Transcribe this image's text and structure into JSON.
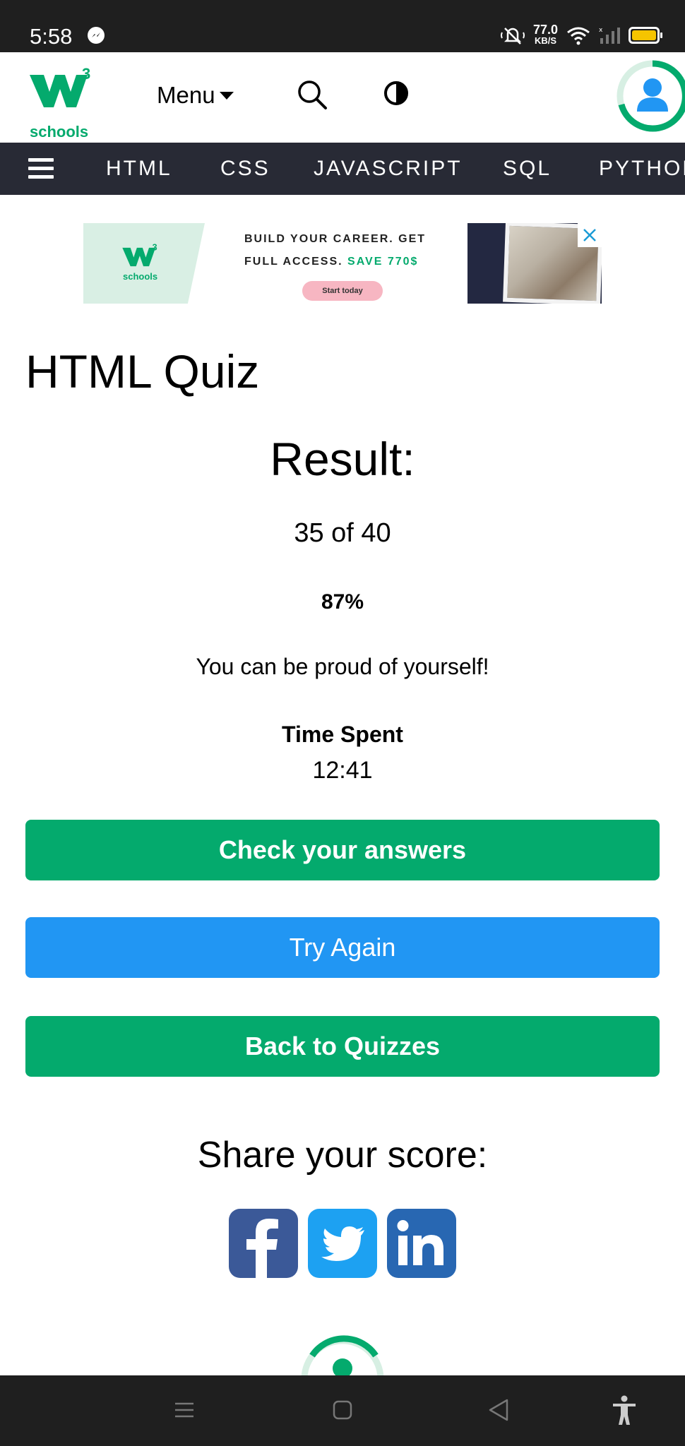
{
  "status_bar": {
    "time": "5:58",
    "net_speed": "77.0",
    "net_speed_unit": "KB/S",
    "battery_color": "#f5c400"
  },
  "header": {
    "logo_text": "schools",
    "menu_label": "Menu",
    "icons": [
      "search-icon",
      "contrast-icon",
      "user-avatar-icon"
    ]
  },
  "subject_nav": {
    "items": [
      "HTML",
      "CSS",
      "JAVASCRIPT",
      "SQL",
      "PYTHON"
    ]
  },
  "ad": {
    "line1": "BUILD YOUR CAREER. GET",
    "line2_prefix": "FULL ACCESS.",
    "line2_highlight": "SAVE 770$",
    "cta": "Start today",
    "logo_text": "schools"
  },
  "main": {
    "title": "HTML Quiz",
    "result_heading": "Result:",
    "score": "35 of 40",
    "percent": "87%",
    "message": "You can be proud of yourself!",
    "time_label": "Time Spent",
    "time_value": "12:41"
  },
  "buttons": {
    "check": "Check your answers",
    "try_again": "Try Again",
    "back": "Back to Quizzes"
  },
  "share": {
    "heading": "Share your score:",
    "networks": [
      "facebook",
      "twitter",
      "linkedin"
    ]
  },
  "colors": {
    "brand_green": "#04AA6D",
    "blue": "#2196F3",
    "nav_dark": "#282A35",
    "facebook": "#3b5998",
    "twitter": "#1da1f2",
    "linkedin": "#2867B2"
  }
}
